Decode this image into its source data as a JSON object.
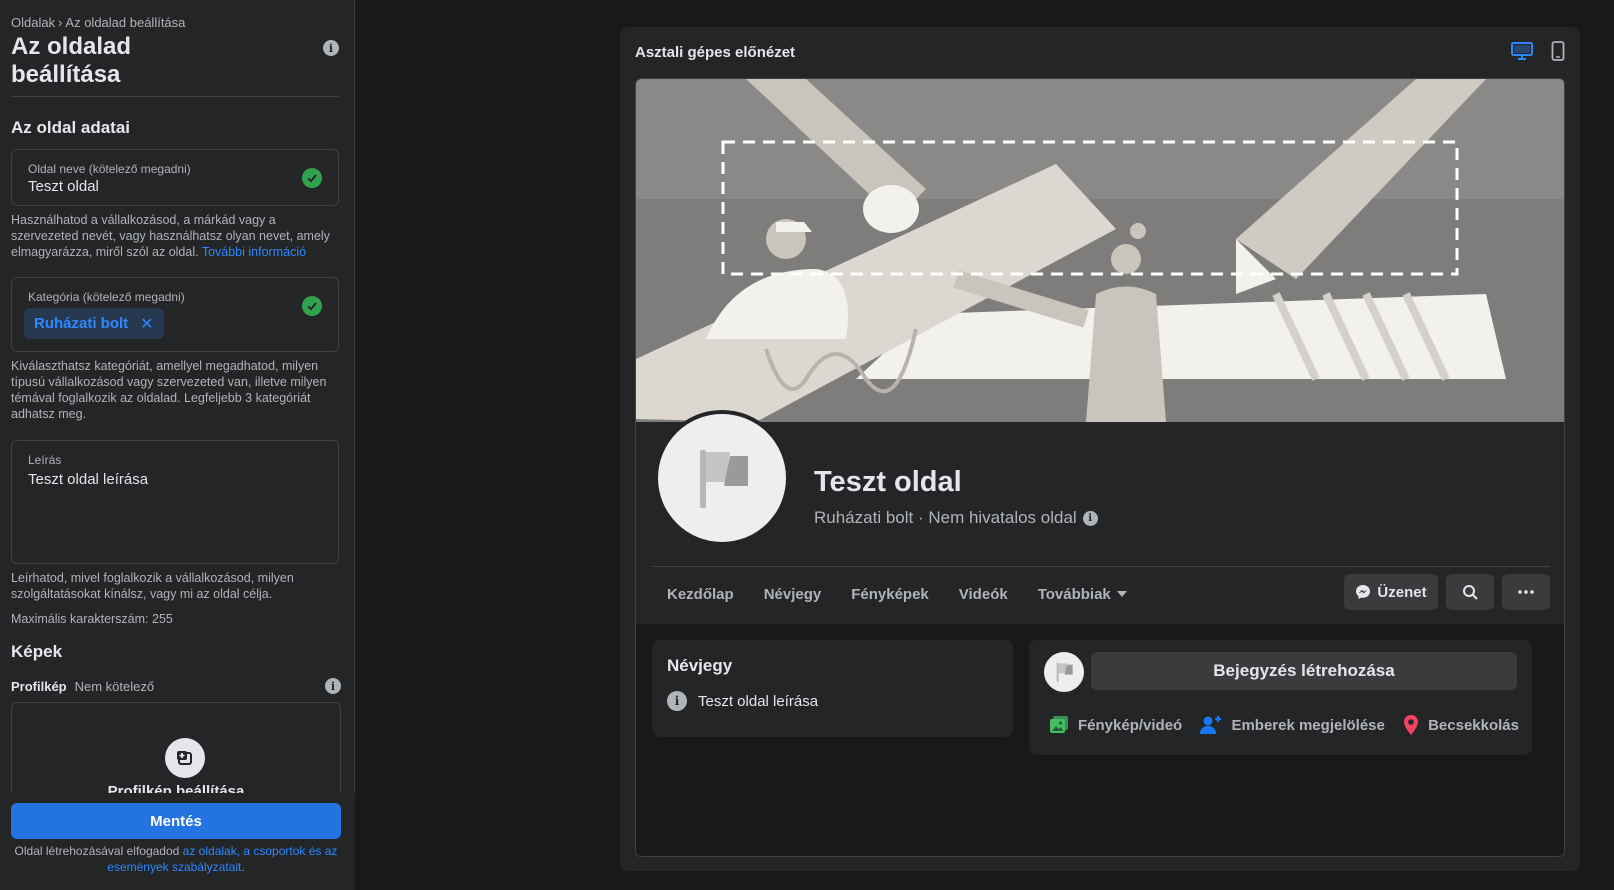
{
  "sidebar": {
    "breadcrumb": {
      "root": "Oldalak",
      "separator": "›",
      "current": "Az oldalad beállítása"
    },
    "title": "Az oldalad beállítása",
    "section_info": "Az oldal adatai",
    "page_name_field": {
      "label": "Oldal neve (kötelező megadni)",
      "value": "Teszt oldal"
    },
    "page_name_help": "Használhatod a vállalkozásod, a márkád vagy a szervezeted nevét, vagy használhatsz olyan nevet, amely elmagyarázza, miről szól az oldal. ",
    "page_name_help_link": "További információ",
    "category_field": {
      "label": "Kategória (kötelező megadni)",
      "chip": "Ruházati bolt",
      "chip_remove": "✕"
    },
    "category_help": "Kiválaszthatsz kategóriát, amellyel megadhatod, milyen típusú vállalkozásod vagy szervezeted van, illetve milyen témával foglalkozik az oldalad. Legfeljebb 3 kategóriát adhatsz meg.",
    "description_field": {
      "label": "Leírás",
      "value": "Teszt oldal leírása"
    },
    "description_help": "Leírhatod, mivel foglalkozik a vállalkozásod, milyen szolgáltatásokat kínálsz, vagy mi az oldal célja.",
    "max_chars": "Maximális karakterszám: 255",
    "section_images": "Képek",
    "profile_pic": {
      "label": "Profilkép",
      "optional": "Nem kötelező",
      "upload_label": "Profilkép beállítása"
    },
    "save_label": "Mentés",
    "terms_text": "Oldal létrehozásával elfogadod ",
    "terms_link": "az oldalak, a csoportok és az események szabályzatait",
    "terms_end": "."
  },
  "preview": {
    "title": "Asztali gépes előnézet",
    "page_name": "Teszt oldal",
    "page_sub": "Ruházati bolt · Nem hivatalos oldal",
    "nav": [
      "Kezdőlap",
      "Névjegy",
      "Fényképek",
      "Videók",
      "Továbbiak"
    ],
    "message_label": "Üzenet",
    "about": {
      "title": "Névjegy",
      "text": "Teszt oldal leírása"
    },
    "composer": {
      "button": "Bejegyzés létrehozása",
      "actions": [
        "Fénykép/videó",
        "Emberek megjelölése",
        "Becsekkolás"
      ]
    }
  },
  "colors": {
    "accent": "#2374e1",
    "link": "#2d88ff",
    "success": "#31a24c",
    "photo_green": "#45bd62",
    "tag_blue": "#1877f2",
    "checkin_red": "#f3425f"
  },
  "icons": [
    "info-icon",
    "check-icon",
    "add-photo-icon",
    "desktop-icon",
    "mobile-icon",
    "flag-icon",
    "messenger-icon",
    "search-icon",
    "more-icon",
    "photo-icon",
    "tag-people-icon",
    "location-icon"
  ]
}
